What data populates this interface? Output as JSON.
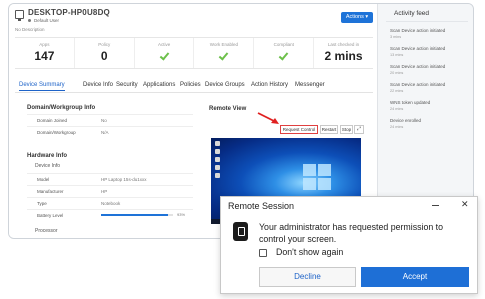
{
  "device": {
    "name": "DESKTOP-HP0U8DQ",
    "user": "Default User",
    "description": "No Description",
    "actions_label": "Actions"
  },
  "stats": [
    {
      "label": "Apps",
      "value": "147"
    },
    {
      "label": "Policy",
      "value": "0"
    },
    {
      "label": "Active",
      "value": ""
    },
    {
      "label": "Work Enabled",
      "value": ""
    },
    {
      "label": "Compliant",
      "value": ""
    },
    {
      "label": "Last checked in",
      "value": "2 mins"
    }
  ],
  "tabs": [
    "Device Summary",
    "Device Info",
    "Security",
    "Applications",
    "Policies",
    "Device Groups",
    "Action History",
    "Messenger"
  ],
  "domain_info": {
    "title": "Domain/Workgroup Info",
    "rows": [
      {
        "key": "Domain Joined",
        "value": "No"
      },
      {
        "key": "Domain/Workgroup",
        "value": "N/A"
      }
    ]
  },
  "hardware_info": {
    "title": "Hardware Info",
    "device_info_label": "Device Info",
    "rows": [
      {
        "key": "Model",
        "value": "HP Laptop 15s-du1xxx"
      },
      {
        "key": "Manufacturer",
        "value": "HP"
      },
      {
        "key": "Type",
        "value": "Notebook"
      },
      {
        "key": "Battery Level",
        "value": "93%"
      }
    ],
    "battery_level": 0.93,
    "processor_label": "Processor"
  },
  "remote_view": {
    "title": "Remote View",
    "request_control_label": "Request Control",
    "restart_label": "Restart",
    "stop_label": "Stop",
    "expand_icon": "expand-icon"
  },
  "activity_feed": {
    "title": "Activity feed",
    "items": [
      {
        "text": "Scan Device action initiated",
        "time": "3 mins"
      },
      {
        "text": "Scan Device action initiated",
        "time": "13 mins"
      },
      {
        "text": "Scan Device action initiated",
        "time": "20 mins"
      },
      {
        "text": "Scan Device action initiated",
        "time": "22 mins"
      },
      {
        "text": "WNS token updated",
        "time": "24 mins"
      },
      {
        "text": "Device enrolled",
        "time": "24 mins"
      }
    ]
  },
  "dialog": {
    "title": "Remote Session",
    "message": "Your administrator has requested permission to control your screen.",
    "checkbox_label": "Don't show again",
    "decline_label": "Decline",
    "accept_label": "Accept"
  },
  "colors": {
    "accent": "#1e6fd6",
    "success": "#6cc04a",
    "highlight_arrow": "#e02020"
  }
}
